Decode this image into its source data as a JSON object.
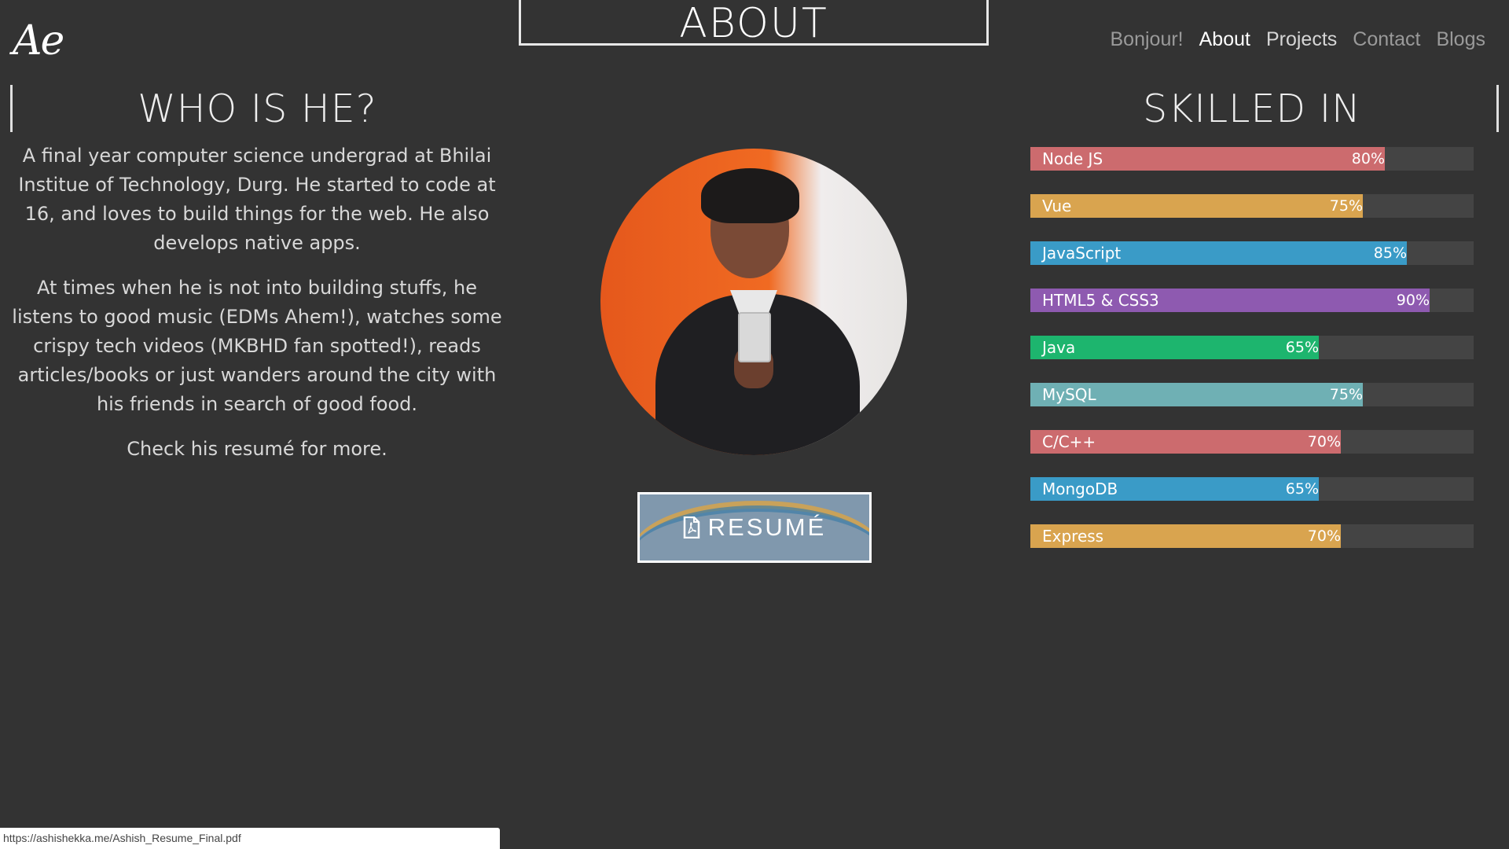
{
  "logo": "Ae",
  "page_title": "ABOUT",
  "nav": [
    {
      "label": "Bonjour!"
    },
    {
      "label": "About"
    },
    {
      "label": "Projects"
    },
    {
      "label": "Contact"
    },
    {
      "label": "Blogs"
    }
  ],
  "who": {
    "heading": "WHO IS HE?",
    "paragraphs": [
      "A final year computer science undergrad at Bhilai Institue of Technology, Durg. He started to code at 16, and loves to build things for the web. He also develops native apps.",
      "At times when he is not into building stuffs, he listens to good music (EDMs Ahem!), watches some crispy tech videos (MKBHD fan spotted!), reads articles/books or just wanders around the city with his friends in search of good food.",
      "Check his resumé for more."
    ]
  },
  "resume": {
    "label": "RESUMÉ",
    "icon": "file-pdf-icon"
  },
  "skills": {
    "heading": "SKILLED IN",
    "items": [
      {
        "name": "Node JS",
        "percent": 80,
        "label": "80%",
        "color": "#cc6b6e"
      },
      {
        "name": "Vue",
        "percent": 75,
        "label": "75%",
        "color": "#d9a44f"
      },
      {
        "name": "JavaScript",
        "percent": 85,
        "label": "85%",
        "color": "#3a9bc7"
      },
      {
        "name": "HTML5 & CSS3",
        "percent": 90,
        "label": "90%",
        "color": "#8e5ab0"
      },
      {
        "name": "Java",
        "percent": 65,
        "label": "65%",
        "color": "#1db56e"
      },
      {
        "name": "MySQL",
        "percent": 75,
        "label": "75%",
        "color": "#6fb0b4"
      },
      {
        "name": "C/C++",
        "percent": 70,
        "label": "70%",
        "color": "#cc6b6e"
      },
      {
        "name": "MongoDB",
        "percent": 65,
        "label": "65%",
        "color": "#3a9bc7"
      },
      {
        "name": "Express",
        "percent": 70,
        "label": "70%",
        "color": "#d9a44f"
      }
    ]
  },
  "status_bar": {
    "url": "https://ashishekka.me/Ashish_Resume_Final.pdf"
  }
}
